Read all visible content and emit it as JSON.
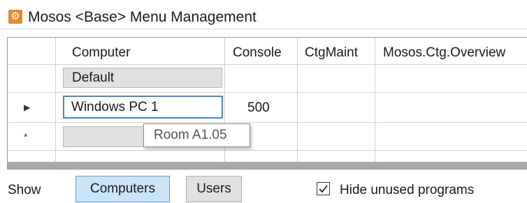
{
  "window": {
    "title": "Mosos <Base> Menu Management",
    "icon": "gear-icon"
  },
  "grid": {
    "columns": [
      "Computer",
      "Console",
      "CtgMaint",
      "Mosos.Ctg.Overview"
    ],
    "rows": [
      {
        "marker": "",
        "computer": "Default",
        "console": ""
      },
      {
        "marker": "▶",
        "computer": "Windows PC 1",
        "console": "500"
      },
      {
        "marker": "*",
        "computer": "",
        "console": ""
      }
    ],
    "tooltip": "Room A1.05"
  },
  "footer": {
    "show_label": "Show",
    "computers_button": "Computers",
    "users_button": "Users",
    "hide_unused_label": "Hide unused programs",
    "hide_unused_checked": true
  },
  "colors": {
    "accent": "#4a86c8",
    "selected_button_bg": "#cce4f7",
    "icon_bg": "#e48a2f"
  }
}
